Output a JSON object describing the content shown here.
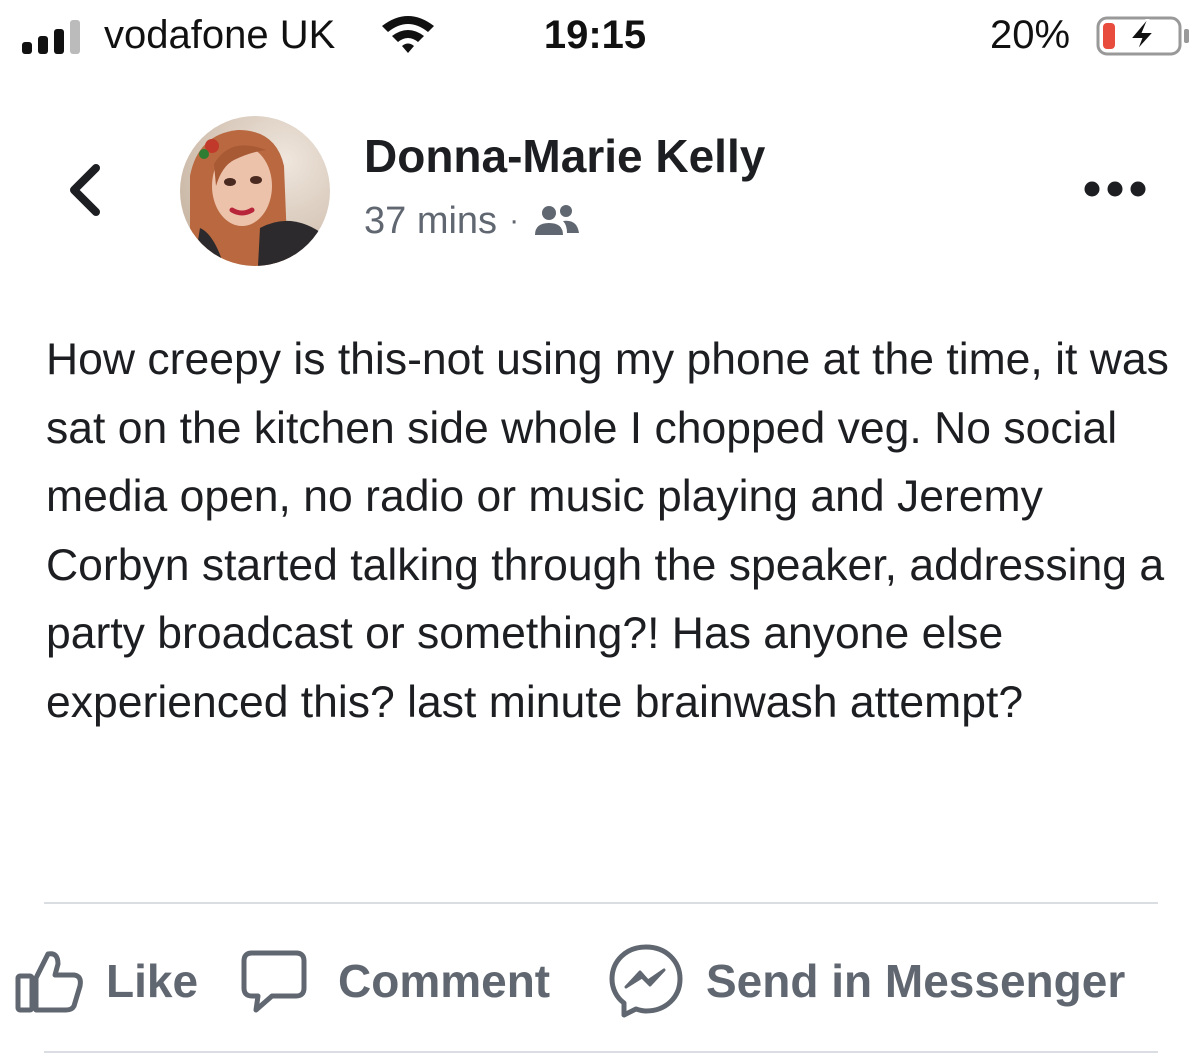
{
  "status_bar": {
    "carrier": "vodafone UK",
    "time": "19:15",
    "battery_percent": "20%",
    "signal_icon": "signal-bars-icon",
    "wifi_icon": "wifi-icon",
    "battery_icon": "battery-charging-icon"
  },
  "post": {
    "author": "Donna-Marie Kelly",
    "timestamp": "37 mins",
    "separator": "·",
    "audience_icon": "friends-audience-icon",
    "back_icon": "chevron-left-icon",
    "more_icon": "more-options-icon",
    "body": "How creepy is this-not using my phone at the time, it was sat on the kitchen side whole I chopped veg. No social media open, no radio or music playing and Jeremy Corbyn started talking through the speaker, addressing a party broadcast or something?! Has anyone else experienced this? last minute brainwash attempt?"
  },
  "actions": {
    "like_label": "Like",
    "comment_label": "Comment",
    "messenger_label": "Send in Messenger"
  },
  "colors": {
    "text_primary": "#1c1e21",
    "text_secondary": "#606770",
    "divider": "#dadde1",
    "battery_low": "#e74c3c"
  }
}
